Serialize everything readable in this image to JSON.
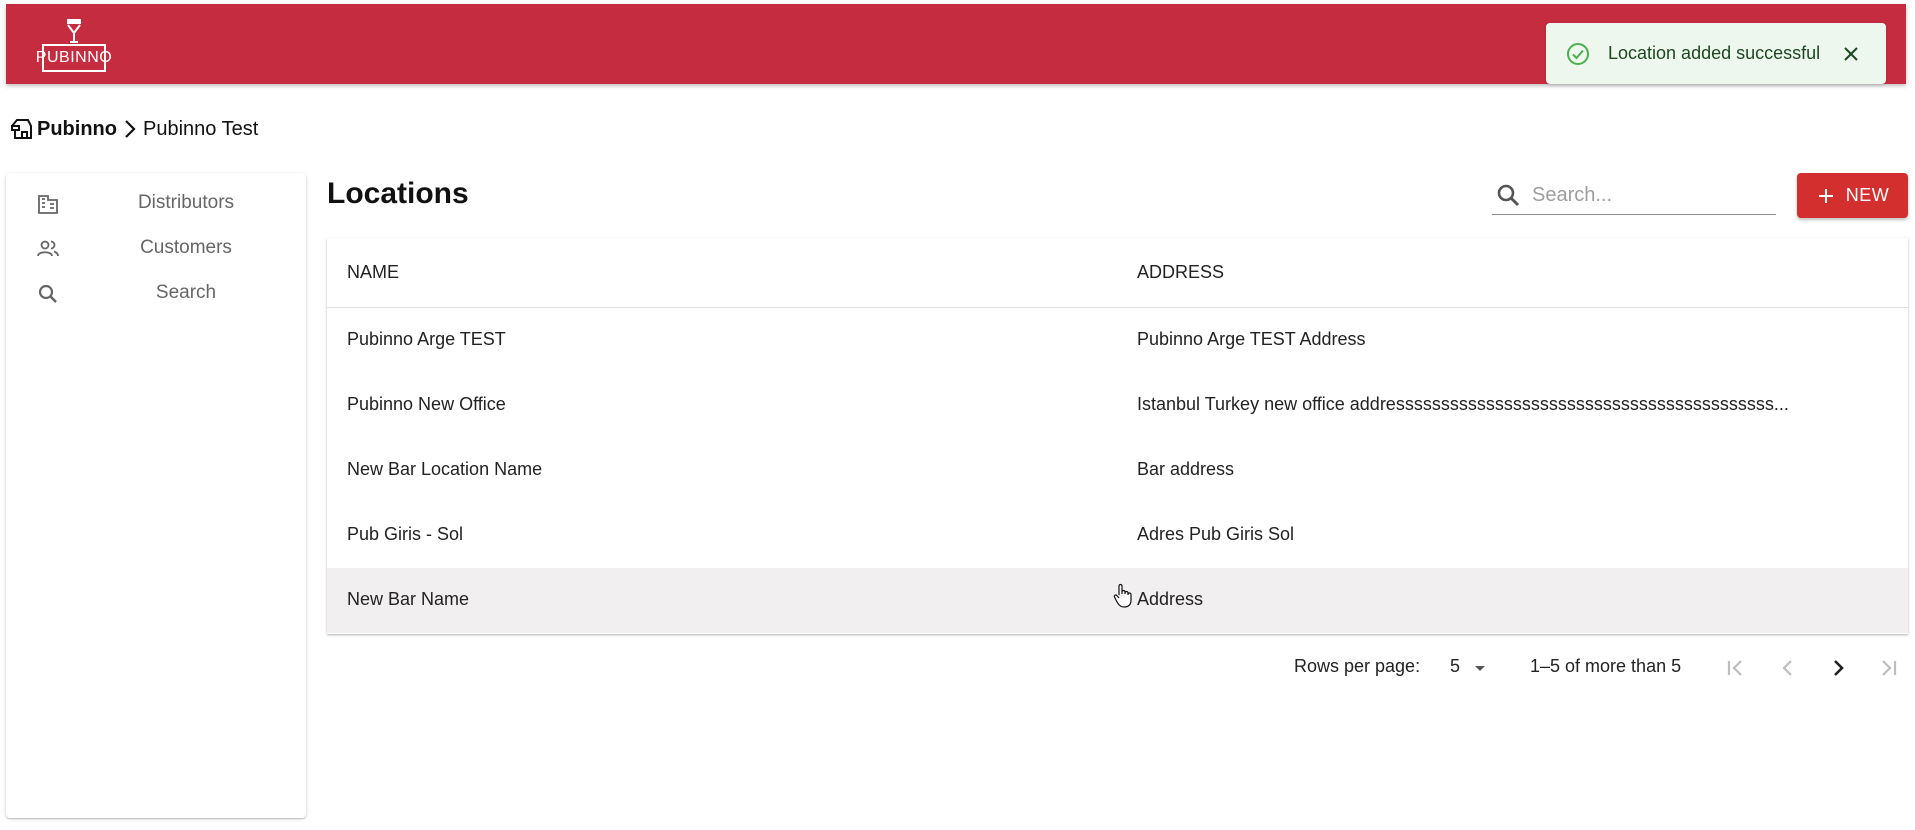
{
  "app": {
    "logo_text": "PUBINNO",
    "brand_color": "#c52c40",
    "accent_color": "#d32f2f"
  },
  "toast": {
    "message": "Location added successful",
    "icon": "check-circle-icon",
    "close_icon": "close-icon"
  },
  "breadcrumb": {
    "home_icon": "store-icon",
    "items": [
      "Pubinno",
      "Pubinno Test"
    ]
  },
  "sidebar": {
    "items": [
      {
        "label": "Distributors",
        "icon": "building-icon"
      },
      {
        "label": "Customers",
        "icon": "people-icon"
      },
      {
        "label": "Search",
        "icon": "search-icon"
      }
    ]
  },
  "main": {
    "title": "Locations",
    "search": {
      "placeholder": "Search...",
      "value": ""
    },
    "new_button": {
      "label": "NEW",
      "icon": "plus-icon"
    }
  },
  "table": {
    "columns": [
      "NAME",
      "ADDRESS"
    ],
    "rows": [
      {
        "name": "Pubinno Arge TEST",
        "address": "Pubinno Arge TEST Address"
      },
      {
        "name": "Pubinno New Office",
        "address": "Istanbul Turkey new office addressssssssssssssssssssssssssssssssssssssssss..."
      },
      {
        "name": "New Bar Location Name",
        "address": "Bar address"
      },
      {
        "name": "Pub Giris - Sol",
        "address": "Adres Pub Giris Sol"
      },
      {
        "name": "New Bar Name",
        "address": "Address"
      }
    ]
  },
  "pagination": {
    "rows_per_page_label": "Rows per page:",
    "rows_per_page_value": "5",
    "range_text": "1–5 of more than 5"
  }
}
